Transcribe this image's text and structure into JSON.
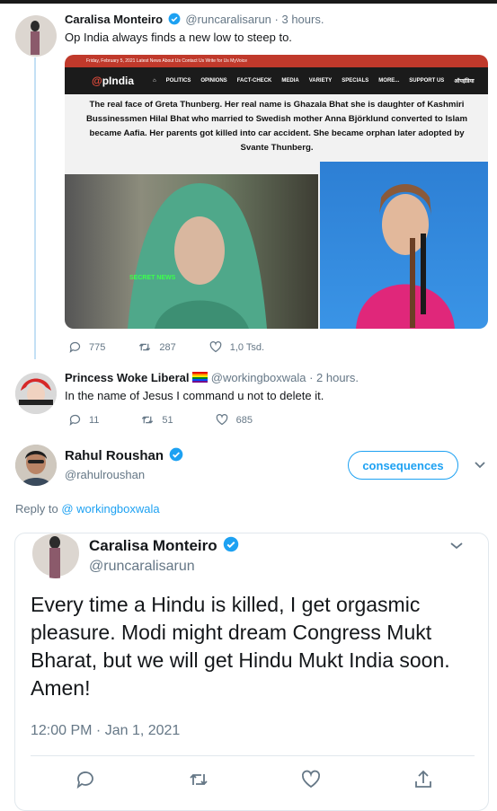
{
  "tweet1": {
    "name": "Caralisa Monteiro",
    "handle": "@runcaralisarun",
    "time": "· 3 hours.",
    "text": "Op India always finds a new low to steep to.",
    "media": {
      "nav_text": "Friday, February 5, 2021   Latest News   About Us   Contact Us   Write for Us   MyVoice",
      "logo_prefix": "@",
      "logo_text": "pIndia",
      "menu": [
        "POLITICS",
        "OPINIONS",
        "FACT-CHECK",
        "MEDIA",
        "VARIETY",
        "SPECIALS",
        "MORE...",
        "SUPPORT US",
        "ऑपइंडिया"
      ],
      "caption": "The real face of Greta Thunberg. Her real name is Ghazala Bhat she is daughter of Kashmiri Bussinessmen Hilal Bhat who married to Swedish mother Anna Björklund converted to Islam became Aafia. Her parents  got killed into car accident. She became orphan later adopted by Svante Thunberg.",
      "watermark": "SECRET NEWS"
    },
    "replies": "775",
    "retweets": "287",
    "likes": "1,0 Tsd."
  },
  "tweet2": {
    "name": "Princess Woke Liberal",
    "handle": "@workingboxwala",
    "time": "· 2 hours.",
    "text": "In the name of Jesus I command u not to delete it.",
    "replies": "11",
    "retweets": "51",
    "likes": "685"
  },
  "tweet3": {
    "name": "Rahul Roushan",
    "handle": "@rahulroushan",
    "follow_label": "consequences",
    "reply_to_prefix": "Reply to",
    "reply_to_handle": "@ workingboxwala"
  },
  "embed": {
    "name": "Caralisa Monteiro",
    "handle": "@runcaralisarun",
    "text": "Every time a Hindu is killed, I get orgasmic pleasure. Modi might dream Congress Mukt Bharat, but we will get Hindu Mukt India soon. Amen!",
    "timestamp": "12:00 PM · Jan 1, 2021"
  },
  "colors": {
    "accent": "#1da1f2",
    "muted": "#657786",
    "thread": "#c4e0f5"
  }
}
